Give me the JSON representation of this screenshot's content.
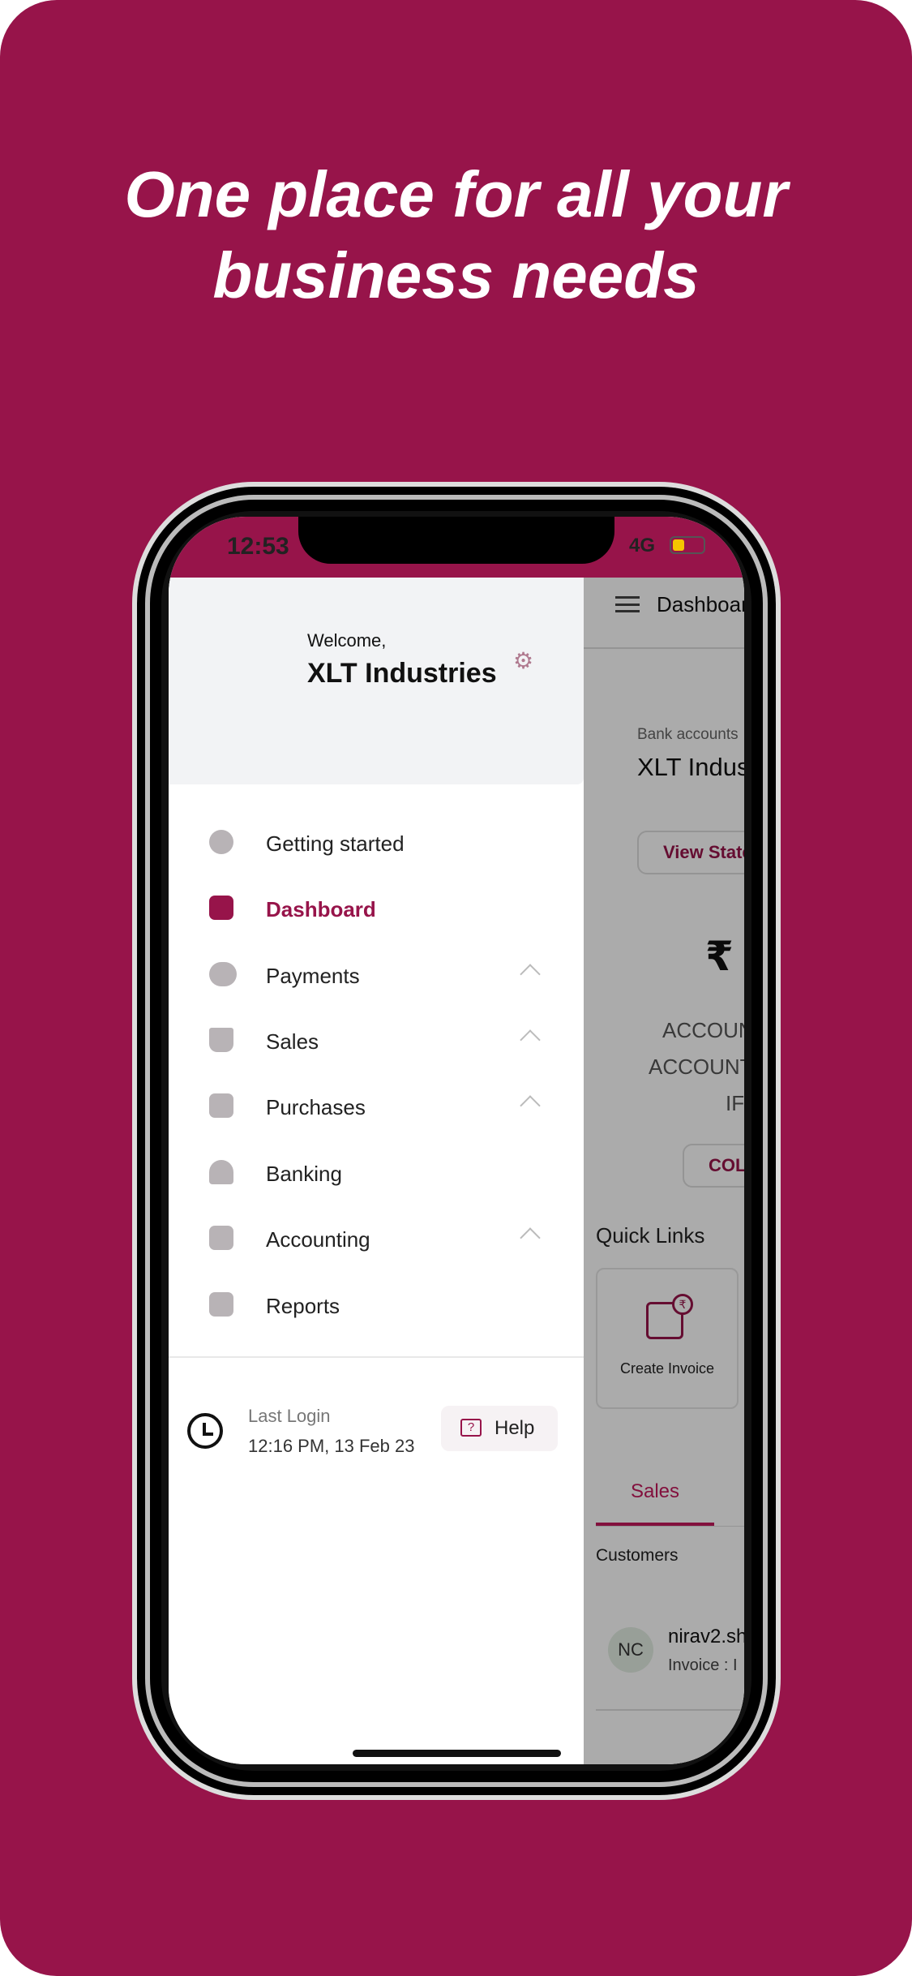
{
  "headline": {
    "line1": "One place for all your",
    "line2": "business needs"
  },
  "colors": {
    "brand": "#97144a",
    "background": "#97144a"
  },
  "status_bar": {
    "time": "12:53",
    "network": "4G",
    "battery_icon": "battery-low-icon"
  },
  "drawer": {
    "welcome": "Welcome,",
    "company": "XLT Industries",
    "settings_icon": "gear-icon",
    "items": [
      {
        "label": "Getting started",
        "icon": "lightbulb-icon",
        "expandable": false
      },
      {
        "label": "Dashboard",
        "icon": "dashboard-icon",
        "expandable": false,
        "active": true
      },
      {
        "label": "Payments",
        "icon": "rupee-coins-icon",
        "expandable": true
      },
      {
        "label": "Sales",
        "icon": "basket-icon",
        "expandable": true
      },
      {
        "label": "Purchases",
        "icon": "box-icon",
        "expandable": true
      },
      {
        "label": "Banking",
        "icon": "bank-icon",
        "expandable": false
      },
      {
        "label": "Accounting",
        "icon": "calculator-icon",
        "expandable": true
      },
      {
        "label": "Reports",
        "icon": "scroll-icon",
        "expandable": false
      }
    ],
    "last_login_label": "Last Login",
    "last_login_value": "12:16 PM, 13 Feb 23",
    "help_label": "Help"
  },
  "main": {
    "title": "Dashboar",
    "bank_accounts_label": "Bank accounts",
    "account_name": "XLT Indus",
    "view_statement": "View State",
    "currency": "₹",
    "account_line1": "ACCOUN",
    "account_line2": "ACCOUNT",
    "account_line3": "IF",
    "collect_button": "COL",
    "quick_links": "Quick Links",
    "quick_link_create_invoice": "Create Invoice",
    "tab_sales": "Sales",
    "customers_label": "Customers",
    "customer": {
      "initials": "NC",
      "name": "nirav2.sh",
      "detail": "Invoice : I"
    }
  }
}
